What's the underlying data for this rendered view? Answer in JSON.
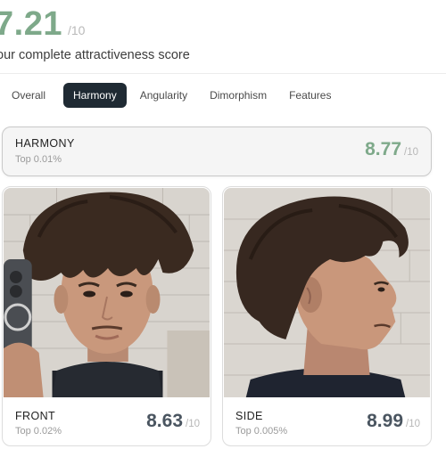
{
  "overall": {
    "score": "7.21",
    "denominator": "/10",
    "subtitle": "our complete attractiveness score"
  },
  "tabs": [
    {
      "label": "Overall",
      "active": false
    },
    {
      "label": "Harmony",
      "active": true
    },
    {
      "label": "Angularity",
      "active": false
    },
    {
      "label": "Dimorphism",
      "active": false
    },
    {
      "label": "Features",
      "active": false
    }
  ],
  "harmony": {
    "title": "HARMONY",
    "rank": "Top 0.01%",
    "score": "8.77",
    "denominator": "/10"
  },
  "front": {
    "title": "FRONT",
    "rank": "Top 0.02%",
    "score": "8.63",
    "denominator": "/10",
    "image": "front-face-photo"
  },
  "side": {
    "title": "SIDE",
    "rank": "Top 0.005%",
    "score": "8.99",
    "denominator": "/10",
    "image": "side-profile-photo"
  },
  "colors": {
    "accent_green": "#7ea98a",
    "score_dark": "#4a5560",
    "active_tab": "#1f2a33"
  }
}
